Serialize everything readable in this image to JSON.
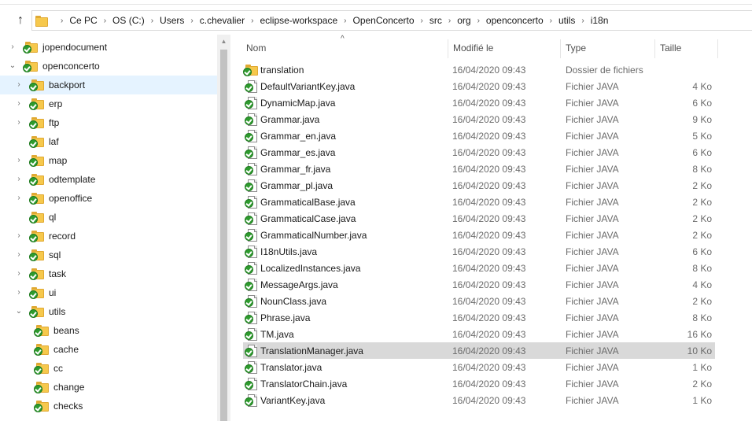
{
  "navigation": {
    "up_arrow": "↑",
    "breadcrumbs": [
      "Ce PC",
      "OS (C:)",
      "Users",
      "c.chevalier",
      "eclipse-workspace",
      "OpenConcerto",
      "src",
      "org",
      "openconcerto",
      "utils",
      "i18n"
    ],
    "separator": "›"
  },
  "sidebar": {
    "items": [
      {
        "label": "jopendocument",
        "chevron": "›",
        "selected": false
      },
      {
        "label": "openconcerto",
        "chevron": "⌄",
        "selected": false
      },
      {
        "label": "backport",
        "chevron": "›",
        "selected": true
      },
      {
        "label": "erp",
        "chevron": "›",
        "selected": false
      },
      {
        "label": "ftp",
        "chevron": "›",
        "selected": false
      },
      {
        "label": "laf",
        "chevron": "",
        "selected": false
      },
      {
        "label": "map",
        "chevron": "›",
        "selected": false
      },
      {
        "label": "odtemplate",
        "chevron": "›",
        "selected": false
      },
      {
        "label": "openoffice",
        "chevron": "›",
        "selected": false
      },
      {
        "label": "ql",
        "chevron": "",
        "selected": false
      },
      {
        "label": "record",
        "chevron": "›",
        "selected": false
      },
      {
        "label": "sql",
        "chevron": "›",
        "selected": false
      },
      {
        "label": "task",
        "chevron": "›",
        "selected": false
      },
      {
        "label": "ui",
        "chevron": "›",
        "selected": false
      },
      {
        "label": "utils",
        "chevron": "⌄",
        "selected": false
      },
      {
        "label": "beans",
        "chevron": "",
        "selected": false
      },
      {
        "label": "cache",
        "chevron": "",
        "selected": false
      },
      {
        "label": "cc",
        "chevron": "",
        "selected": false
      },
      {
        "label": "change",
        "chevron": "",
        "selected": false
      },
      {
        "label": "checks",
        "chevron": "",
        "selected": false
      }
    ]
  },
  "columns": {
    "name": "Nom",
    "date": "Modifié le",
    "type": "Type",
    "size": "Taille",
    "sort_indicator": "^"
  },
  "files": [
    {
      "name": "translation",
      "date": "16/04/2020 09:43",
      "type": "Dossier de fichiers",
      "size": "",
      "kind": "folder",
      "selected": false
    },
    {
      "name": "DefaultVariantKey.java",
      "date": "16/04/2020 09:43",
      "type": "Fichier JAVA",
      "size": "4 Ko",
      "kind": "file",
      "selected": false
    },
    {
      "name": "DynamicMap.java",
      "date": "16/04/2020 09:43",
      "type": "Fichier JAVA",
      "size": "6 Ko",
      "kind": "file",
      "selected": false
    },
    {
      "name": "Grammar.java",
      "date": "16/04/2020 09:43",
      "type": "Fichier JAVA",
      "size": "9 Ko",
      "kind": "file",
      "selected": false
    },
    {
      "name": "Grammar_en.java",
      "date": "16/04/2020 09:43",
      "type": "Fichier JAVA",
      "size": "5 Ko",
      "kind": "file",
      "selected": false
    },
    {
      "name": "Grammar_es.java",
      "date": "16/04/2020 09:43",
      "type": "Fichier JAVA",
      "size": "6 Ko",
      "kind": "file",
      "selected": false
    },
    {
      "name": "Grammar_fr.java",
      "date": "16/04/2020 09:43",
      "type": "Fichier JAVA",
      "size": "8 Ko",
      "kind": "file",
      "selected": false
    },
    {
      "name": "Grammar_pl.java",
      "date": "16/04/2020 09:43",
      "type": "Fichier JAVA",
      "size": "2 Ko",
      "kind": "file",
      "selected": false
    },
    {
      "name": "GrammaticalBase.java",
      "date": "16/04/2020 09:43",
      "type": "Fichier JAVA",
      "size": "2 Ko",
      "kind": "file",
      "selected": false
    },
    {
      "name": "GrammaticalCase.java",
      "date": "16/04/2020 09:43",
      "type": "Fichier JAVA",
      "size": "2 Ko",
      "kind": "file",
      "selected": false
    },
    {
      "name": "GrammaticalNumber.java",
      "date": "16/04/2020 09:43",
      "type": "Fichier JAVA",
      "size": "2 Ko",
      "kind": "file",
      "selected": false
    },
    {
      "name": "I18nUtils.java",
      "date": "16/04/2020 09:43",
      "type": "Fichier JAVA",
      "size": "6 Ko",
      "kind": "file",
      "selected": false
    },
    {
      "name": "LocalizedInstances.java",
      "date": "16/04/2020 09:43",
      "type": "Fichier JAVA",
      "size": "8 Ko",
      "kind": "file",
      "selected": false
    },
    {
      "name": "MessageArgs.java",
      "date": "16/04/2020 09:43",
      "type": "Fichier JAVA",
      "size": "4 Ko",
      "kind": "file",
      "selected": false
    },
    {
      "name": "NounClass.java",
      "date": "16/04/2020 09:43",
      "type": "Fichier JAVA",
      "size": "2 Ko",
      "kind": "file",
      "selected": false
    },
    {
      "name": "Phrase.java",
      "date": "16/04/2020 09:43",
      "type": "Fichier JAVA",
      "size": "8 Ko",
      "kind": "file",
      "selected": false
    },
    {
      "name": "TM.java",
      "date": "16/04/2020 09:43",
      "type": "Fichier JAVA",
      "size": "16 Ko",
      "kind": "file",
      "selected": false
    },
    {
      "name": "TranslationManager.java",
      "date": "16/04/2020 09:43",
      "type": "Fichier JAVA",
      "size": "10 Ko",
      "kind": "file",
      "selected": true
    },
    {
      "name": "Translator.java",
      "date": "16/04/2020 09:43",
      "type": "Fichier JAVA",
      "size": "1 Ko",
      "kind": "file",
      "selected": false
    },
    {
      "name": "TranslatorChain.java",
      "date": "16/04/2020 09:43",
      "type": "Fichier JAVA",
      "size": "2 Ko",
      "kind": "file",
      "selected": false
    },
    {
      "name": "VariantKey.java",
      "date": "16/04/2020 09:43",
      "type": "Fichier JAVA",
      "size": "1 Ko",
      "kind": "file",
      "selected": false
    }
  ],
  "colors": {
    "selection_sidebar": "#e5f3ff",
    "selection_row": "#d9d9d9",
    "folder": "#f6c84c",
    "check": "#2e9b2e"
  }
}
